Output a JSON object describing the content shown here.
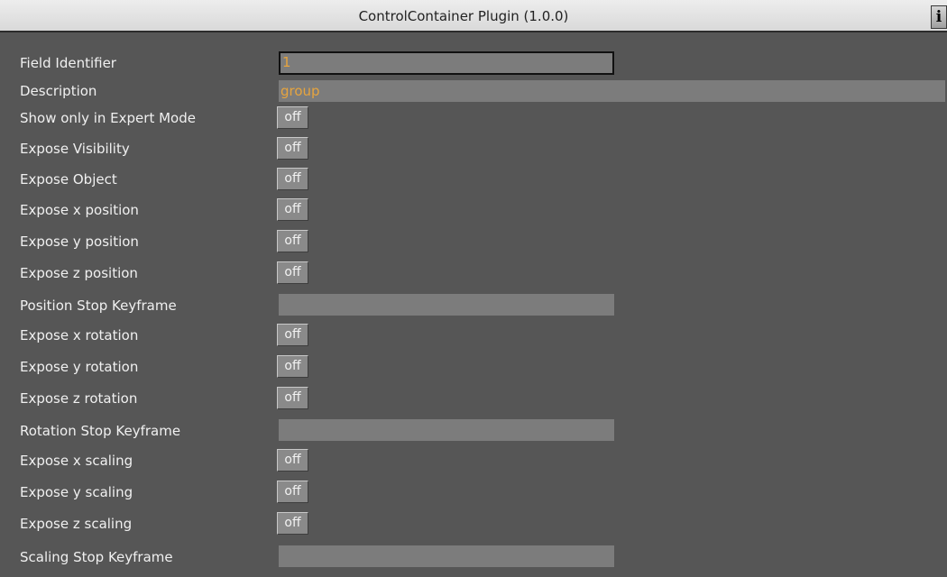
{
  "window": {
    "title": "ControlContainer Plugin (1.0.0)",
    "info_button": "i"
  },
  "fields": {
    "field_identifier": {
      "label": "Field Identifier",
      "value": "1"
    },
    "description": {
      "label": "Description",
      "value": "group"
    }
  },
  "toggles": [
    {
      "label": "Show only in Expert Mode",
      "value": "off"
    },
    {
      "label": "Expose Visibility",
      "value": "off"
    },
    {
      "label": "Expose Object",
      "value": "off"
    },
    {
      "label": "Expose x position",
      "value": "off"
    },
    {
      "label": "Expose y position",
      "value": "off"
    },
    {
      "label": "Expose z position",
      "value": "off"
    },
    {
      "label": "Expose x rotation",
      "value": "off"
    },
    {
      "label": "Expose y rotation",
      "value": "off"
    },
    {
      "label": "Expose z rotation",
      "value": "off"
    },
    {
      "label": "Expose x scaling",
      "value": "off"
    },
    {
      "label": "Expose y scaling",
      "value": "off"
    },
    {
      "label": "Expose z scaling",
      "value": "off"
    }
  ],
  "keyframes": {
    "position": {
      "label": "Position Stop Keyframe",
      "value": ""
    },
    "rotation": {
      "label": "Rotation Stop Keyframe",
      "value": ""
    },
    "scaling": {
      "label": "Scaling Stop Keyframe",
      "value": ""
    }
  },
  "colors": {
    "panel_background": "#565656",
    "field_value_text": "#e6a43e"
  }
}
